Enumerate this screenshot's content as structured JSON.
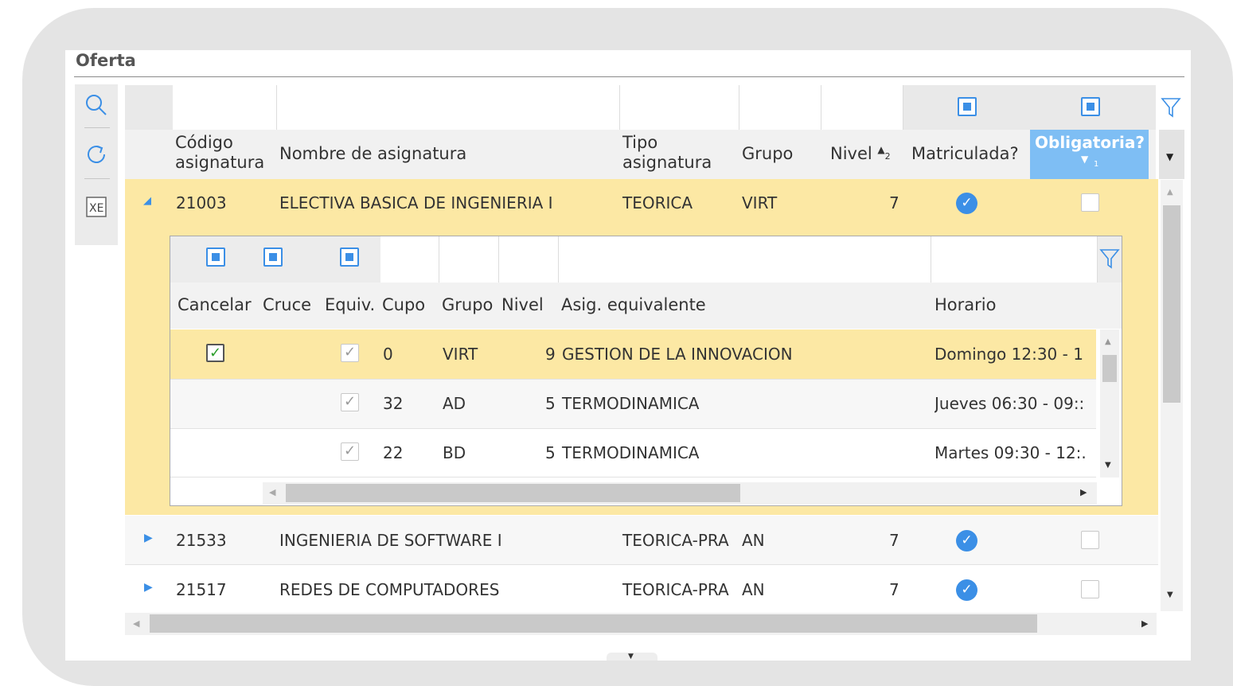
{
  "panel": {
    "title": "Oferta"
  },
  "toolbar": [
    {
      "icon": "search-icon"
    },
    {
      "icon": "refresh-icon"
    },
    {
      "icon": "excel-export-icon"
    }
  ],
  "grid": {
    "columns": {
      "codigo": "Código asignatura",
      "codigo_l1": "Código",
      "codigo_l2": "asignatura",
      "nombre": "Nombre de asignatura",
      "tipo_l1": "Tipo",
      "tipo_l2": "asignatura",
      "grupo": "Grupo",
      "nivel": "Nivel",
      "nivel_sort_index": "2",
      "matriculada": "Matriculada?",
      "obligatoria": "Obligatoria?",
      "obligatoria_sort_index": "1"
    },
    "rows": [
      {
        "codigo": "21003",
        "nombre": "ELECTIVA BASICA DE INGENIERIA I",
        "tipo": "TEORICA",
        "grupo": "VIRT",
        "nivel": "7",
        "matriculada": true,
        "obligatoria": false,
        "expanded": true
      },
      {
        "codigo": "21533",
        "nombre": "INGENIERIA DE SOFTWARE I",
        "tipo": "TEORICA-PRA",
        "grupo": "AN",
        "nivel": "7",
        "matriculada": true,
        "obligatoria": false,
        "expanded": false
      },
      {
        "codigo": "21517",
        "nombre": "REDES DE COMPUTADORES",
        "tipo": "TEORICA-PRA",
        "grupo": "AN",
        "nivel": "7",
        "matriculada": true,
        "obligatoria": false,
        "expanded": false
      }
    ]
  },
  "subgrid": {
    "columns": {
      "cancelar": "Cancelar",
      "cruce": "Cruce",
      "equiv": "Equiv.",
      "cupo": "Cupo",
      "grupo": "Grupo",
      "nivel": "Nivel",
      "asig_equivalente": "Asig. equivalente",
      "horario": "Horario"
    },
    "rows": [
      {
        "cancelar": true,
        "cruce": false,
        "equiv": true,
        "cupo": "0",
        "grupo": "VIRT",
        "nivel": "9",
        "asig_equivalente": "GESTION DE LA INNOVACION",
        "horario": "Domingo 12:30 - 1"
      },
      {
        "cancelar": false,
        "cruce": false,
        "equiv": true,
        "cupo": "32",
        "grupo": "AD",
        "nivel": "5",
        "asig_equivalente": "TERMODINAMICA",
        "horario": "Jueves 06:30 - 09::"
      },
      {
        "cancelar": false,
        "cruce": false,
        "equiv": true,
        "cupo": "22",
        "grupo": "BD",
        "nivel": "5",
        "asig_equivalente": "TERMODINAMICA",
        "horario": "Martes 09:30 - 12:."
      }
    ]
  },
  "colors": {
    "selected_row": "#fce8a4",
    "accent": "#3b8fe6",
    "active_header": "#7ebef4"
  }
}
